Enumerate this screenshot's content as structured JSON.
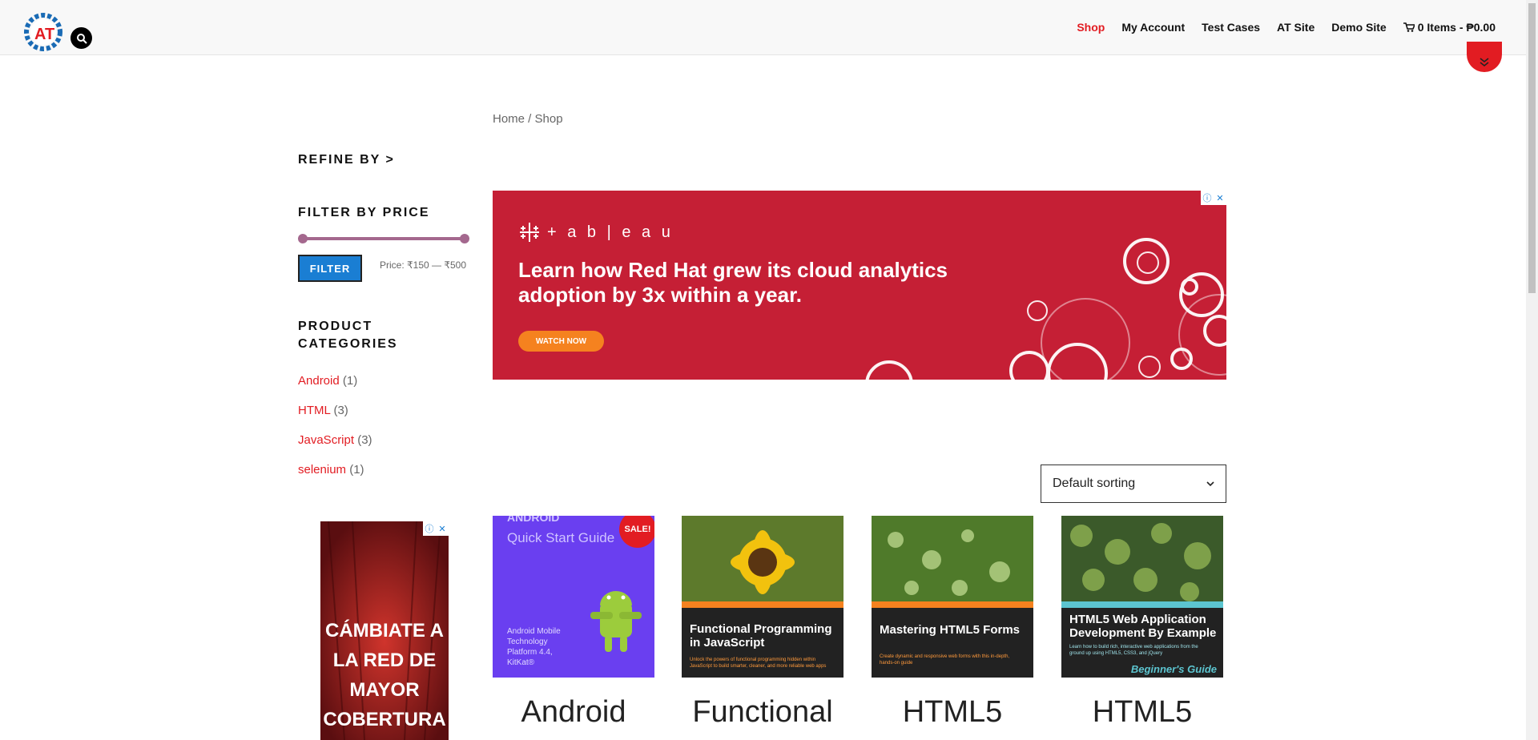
{
  "nav": {
    "items": [
      "Shop",
      "My Account",
      "Test Cases",
      "AT Site",
      "Demo Site"
    ],
    "cart": "0 Items - ₱0.00",
    "logo_text": "AT"
  },
  "breadcrumb": "Home / Shop",
  "sidebar": {
    "refine_title": "REFINE BY >",
    "filter_title": "FILTER BY PRICE",
    "filter_button": "FILTER",
    "price_label": "Price: ₹150 — ₹500",
    "price_range_fraction": [
      0,
      1
    ],
    "categories_title": "PRODUCT CATEGORIES",
    "categories": [
      {
        "name": "Android",
        "count": "(1)"
      },
      {
        "name": "HTML",
        "count": "(3)"
      },
      {
        "name": "JavaScript",
        "count": "(3)"
      },
      {
        "name": "selenium",
        "count": "(1)"
      }
    ]
  },
  "ad_main": {
    "brand": "+ a b | e a u",
    "headline": "Learn how Red Hat grew its cloud analytics adoption by 3x within a year.",
    "cta": "WATCH NOW"
  },
  "ad_side": {
    "text": "CÁMBIATE A LA RED DE MAYOR COBERTURA"
  },
  "sort": {
    "selected": "Default sorting"
  },
  "products": [
    {
      "name": "Android",
      "sale": "SALE!",
      "cover_top": "ANDROID",
      "cover_title": "Quick Start Guide",
      "cover_sub": "Android Mobile Technology Platform 4.4, KitKat®"
    },
    {
      "name": "Functional",
      "cover_title": "Functional Programming in JavaScript",
      "cover_sub": "Unlock the powers of functional programming hidden within JavaScript to build smarter, cleaner, and more reliable web apps"
    },
    {
      "name": "HTML5",
      "cover_title": "Mastering HTML5 Forms",
      "cover_sub": "Create dynamic and responsive web forms with this in-depth, hands-on guide"
    },
    {
      "name": "HTML5",
      "cover_title": "HTML5 Web Application Development By Example",
      "cover_sub": "Learn how to build rich, interactive web applications from the ground up using HTML5, CSS3, and jQuery",
      "cover_badge": "Beginner's Guide"
    }
  ],
  "colors": {
    "accent": "#e21c22",
    "button": "#1a7ed3",
    "slider": "#a4688e"
  }
}
